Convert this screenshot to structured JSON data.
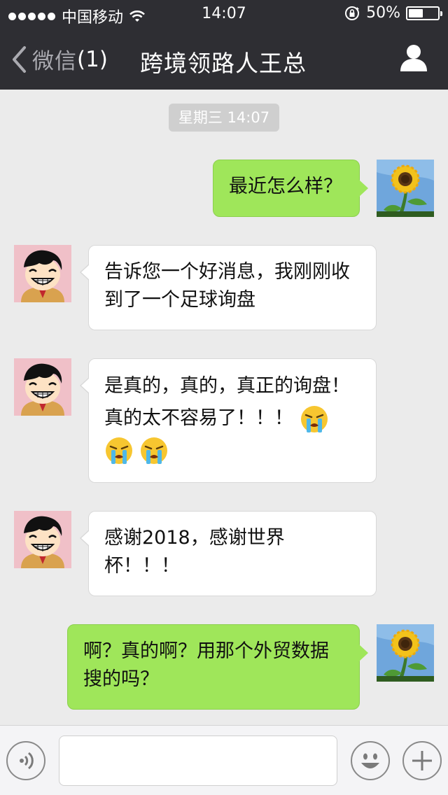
{
  "status_bar": {
    "carrier": "中国移动",
    "time": "14:07",
    "battery_percent_label": "50%",
    "battery_level": 0.5
  },
  "nav": {
    "back_label": "微信",
    "back_count": "(1)",
    "title": "跨境领路人王总"
  },
  "chat": {
    "timestamp": "星期三 14:07",
    "messages": [
      {
        "direction": "out",
        "sender": "self",
        "lines": [
          "最近怎么样？"
        ]
      },
      {
        "direction": "in",
        "sender": "wang",
        "lines": [
          "告诉您一个好消息，我刚刚收",
          "到了一个足球询盘"
        ]
      },
      {
        "direction": "in",
        "sender": "wang",
        "lines": [
          "是真的，真的，真正的询盘！",
          "真的太不容易了！！！"
        ],
        "trailing_emojis": [
          "crying-face",
          "crying-face",
          "crying-face"
        ]
      },
      {
        "direction": "in",
        "sender": "wang",
        "lines": [
          "感谢2018，感谢世界",
          "杯！！！"
        ]
      },
      {
        "direction": "out",
        "sender": "self",
        "lines": [
          "啊？真的啊？用那个外贸数据",
          "搜的吗？"
        ]
      }
    ]
  },
  "input_bar": {
    "voice_icon": "voice-icon",
    "emoji_icon": "emoji-icon",
    "plus_icon": "plus-icon",
    "input_value": ""
  },
  "colors": {
    "bar_bg": "#2e2e33",
    "chat_bg": "#ebebeb",
    "outgoing_bubble": "#9fe65a",
    "incoming_bubble": "#ffffff",
    "timestamp_bg": "#cfcfcf"
  }
}
